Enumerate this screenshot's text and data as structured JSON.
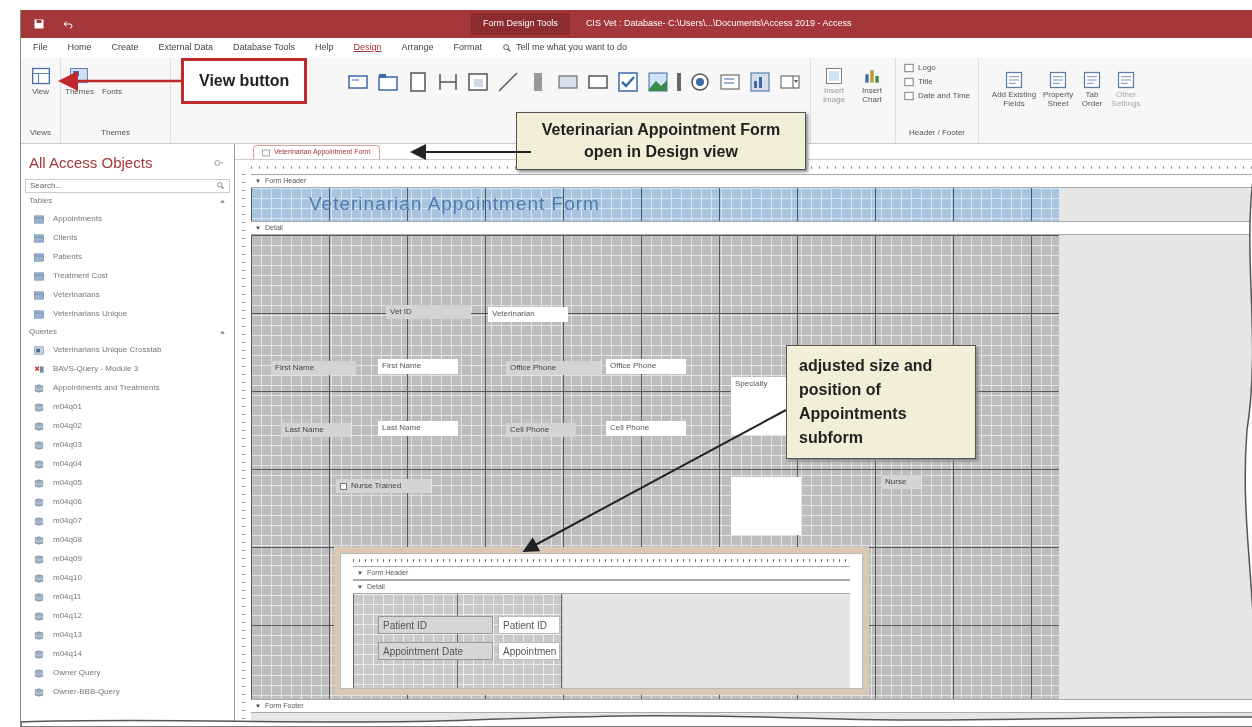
{
  "title_bar": {
    "context": "Form Design Tools",
    "title": "CIS Vet : Database- C:\\Users\\...\\Documents\\Access 2019 - Access"
  },
  "ribbon_tabs": [
    {
      "label": "File",
      "selected": false
    },
    {
      "label": "Home",
      "selected": false
    },
    {
      "label": "Create",
      "selected": false
    },
    {
      "label": "External Data",
      "selected": false
    },
    {
      "label": "Database Tools",
      "selected": false
    },
    {
      "label": "Help",
      "selected": false
    },
    {
      "label": "Design",
      "selected": true
    },
    {
      "label": "Arrange",
      "selected": false
    },
    {
      "label": "Format",
      "selected": false
    }
  ],
  "tell_me": "Tell me what you want to do",
  "ribbon": {
    "view": "View",
    "themes": "Themes",
    "fonts": "Fonts",
    "groups": [
      "Views",
      "Themes",
      "Header / Footer"
    ],
    "insert": [
      "Insert Image",
      "Insert Chart"
    ],
    "header_footer": [
      "Logo",
      "Title",
      "Date and Time"
    ],
    "tools": [
      "Add Existing Fields",
      "Property Sheet",
      "Tab Order",
      "Other Settings"
    ]
  },
  "callouts": [
    {
      "kind": "boxed",
      "text": "View button"
    },
    {
      "kind": "note",
      "text": "Veterinarian Appointment Form open in Design view"
    },
    {
      "kind": "note",
      "text": "adjusted size and position of Appointments subform"
    }
  ],
  "nav": {
    "title": "All Access Objects",
    "search_placeholder": "Search...",
    "groups": [
      {
        "label": "Tables",
        "items": [
          {
            "kind": "table",
            "label": "Appointments"
          },
          {
            "kind": "table",
            "label": "Clients"
          },
          {
            "kind": "table",
            "label": "Patients"
          },
          {
            "kind": "table",
            "label": "Treatment Cost"
          },
          {
            "kind": "table",
            "label": "Veterinarians"
          },
          {
            "kind": "table",
            "label": "Veterinarians Unique"
          }
        ]
      },
      {
        "label": "Queries",
        "items": [
          {
            "kind": "crosstab",
            "label": "Veterinarians Unique Crosstab"
          },
          {
            "kind": "delete",
            "label": "BAVS-Query - Module 3"
          },
          {
            "kind": "select",
            "label": "Appointments and Treatments"
          },
          {
            "kind": "select",
            "label": "m04q01"
          },
          {
            "kind": "select",
            "label": "m04q02"
          },
          {
            "kind": "select",
            "label": "m04q03"
          },
          {
            "kind": "select",
            "label": "m04q04"
          },
          {
            "kind": "select",
            "label": "m04q05"
          },
          {
            "kind": "select",
            "label": "m04q06"
          },
          {
            "kind": "select",
            "label": "m04q07"
          },
          {
            "kind": "select",
            "label": "m04q08"
          },
          {
            "kind": "select",
            "label": "m04q09"
          },
          {
            "kind": "select",
            "label": "m04q10"
          },
          {
            "kind": "select",
            "label": "m04q11"
          },
          {
            "kind": "select",
            "label": "m04q12"
          },
          {
            "kind": "select",
            "label": "m04q13"
          },
          {
            "kind": "select",
            "label": "m04q14"
          },
          {
            "kind": "select",
            "label": "Owner Query"
          },
          {
            "kind": "select",
            "label": "Owner-BBB-Query"
          }
        ]
      }
    ]
  },
  "document_tab": "Veterinarian Appointment Form",
  "form": {
    "header_bar": "Form Header",
    "header_title": "Veterinarian Appointment Form",
    "detail_bar": "Detail",
    "footer_bar": "Form Footer",
    "controls": [
      {
        "kind": "label",
        "text": "Vet ID"
      },
      {
        "kind": "textbox",
        "text": "Veterinarian"
      },
      {
        "kind": "label",
        "text": "First Name"
      },
      {
        "kind": "textbox",
        "text": "First Name"
      },
      {
        "kind": "label",
        "text": "Office Phone"
      },
      {
        "kind": "textbox",
        "text": "Office Phone"
      },
      {
        "kind": "textbox",
        "text": "Specialty"
      },
      {
        "kind": "label",
        "text": "Last Name"
      },
      {
        "kind": "textbox",
        "text": "Last Name"
      },
      {
        "kind": "label",
        "text": "Cell Phone"
      },
      {
        "kind": "textbox",
        "text": "Cell Phone"
      },
      {
        "kind": "checkbox",
        "text": "Nurse Trained"
      },
      {
        "kind": "textbox"
      },
      {
        "kind": "label",
        "text": "Nurse"
      }
    ],
    "subform": {
      "header_bar": "Form Header",
      "detail_bar": "Detail",
      "controls": [
        {
          "kind": "label",
          "text": "Patient ID"
        },
        {
          "kind": "textbox",
          "text": "Patient ID"
        },
        {
          "kind": "label",
          "text": "Appointment Date"
        },
        {
          "kind": "textbox",
          "text": "Appointmen"
        }
      ]
    }
  }
}
